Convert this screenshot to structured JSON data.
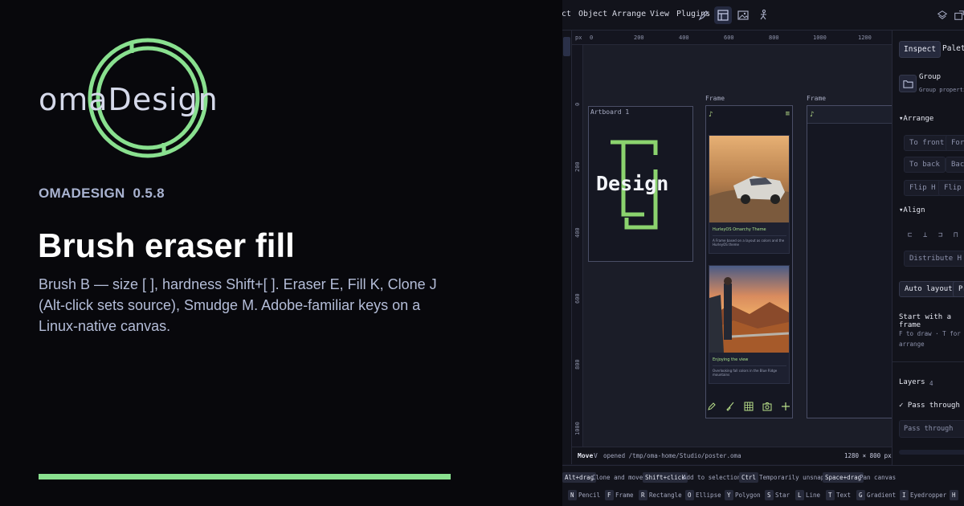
{
  "brand": {
    "logo_text": "omaDesign",
    "name": "OMADESIGN",
    "version": "0.5.8",
    "accent": "#89e08f"
  },
  "hero": {
    "title": "Brush eraser fill",
    "description": "Brush B — size [ ], hardness Shift+[ ]. Eraser E, Fill K, Clone J (Alt-click sets source), Smudge M. Adobe-familiar keys on a Linux-native canvas."
  },
  "app": {
    "menu": [
      "ct",
      "Object",
      "Arrange",
      "View",
      "Plugins"
    ],
    "toolbar_icons": [
      "pen-icon",
      "layout-icon",
      "image-icon",
      "figure-icon"
    ],
    "ruler": {
      "unit": "px",
      "h_ticks": [
        "0",
        "200",
        "400",
        "600",
        "800",
        "1000",
        "1200"
      ],
      "v_ticks": [
        "0",
        "200",
        "400",
        "600",
        "800",
        "1000"
      ]
    },
    "canvas": {
      "artboard_label": "Artboard 1",
      "frame_labels": [
        "Frame",
        "Frame"
      ],
      "logo_text": "Design",
      "cards": [
        {
          "title": "HurleyOS Omarchy Theme",
          "text": "A Frame based on a layout as colors and the HurleyOS theme"
        },
        {
          "title": "Enjoying the view",
          "text": "Overlooking fall colors in the Blue Ridge mountains"
        }
      ],
      "card_tools": [
        "pen-icon",
        "brush-icon",
        "grid-icon",
        "camera-icon",
        "plus-icon"
      ]
    },
    "status": {
      "mode": "Move",
      "key": "V",
      "file": "opened /tmp/oma-home/Studio/poster.oma",
      "size": "1280 × 800 px"
    },
    "hints_row1": [
      {
        "key": "Alt+drag",
        "label": "Clone and move"
      },
      {
        "key": "Shift+click",
        "label": "Add to selection"
      },
      {
        "key": "Ctrl",
        "label": "Temporarily unsnap"
      },
      {
        "key": "Space+drag",
        "label": "Pan canvas"
      }
    ],
    "hints_row2": [
      {
        "key": "N",
        "label": "Pencil"
      },
      {
        "key": "F",
        "label": "Frame"
      },
      {
        "key": "R",
        "label": "Rectangle"
      },
      {
        "key": "O",
        "label": "Ellipse"
      },
      {
        "key": "Y",
        "label": "Polygon"
      },
      {
        "key": "S",
        "label": "Star"
      },
      {
        "key": "L",
        "label": "Line"
      },
      {
        "key": "T",
        "label": "Text"
      },
      {
        "key": "G",
        "label": "Gradient"
      },
      {
        "key": "I",
        "label": "Eyedropper"
      },
      {
        "key": "H",
        "label": ""
      }
    ],
    "inspector": {
      "tabs": [
        "Inspect",
        "Palette"
      ],
      "group_title": "Group",
      "group_sub": "Group properties",
      "arrange_title": "Arrange",
      "arrange_buttons": [
        "To front",
        "Forward",
        "To back",
        "Backward",
        "Flip H",
        "Flip V"
      ],
      "align_title": "Align",
      "distribute": "Distribute H",
      "auto_layout": "Auto layout",
      "pr_button": "Pr",
      "start_title": "Start with a frame",
      "start_hint": "F to draw · T for text",
      "start_hint2": "arrange",
      "layers_title": "Layers",
      "layers_count": "4",
      "pass_through_check": "Pass through",
      "pass_through_select": "Pass through"
    }
  }
}
